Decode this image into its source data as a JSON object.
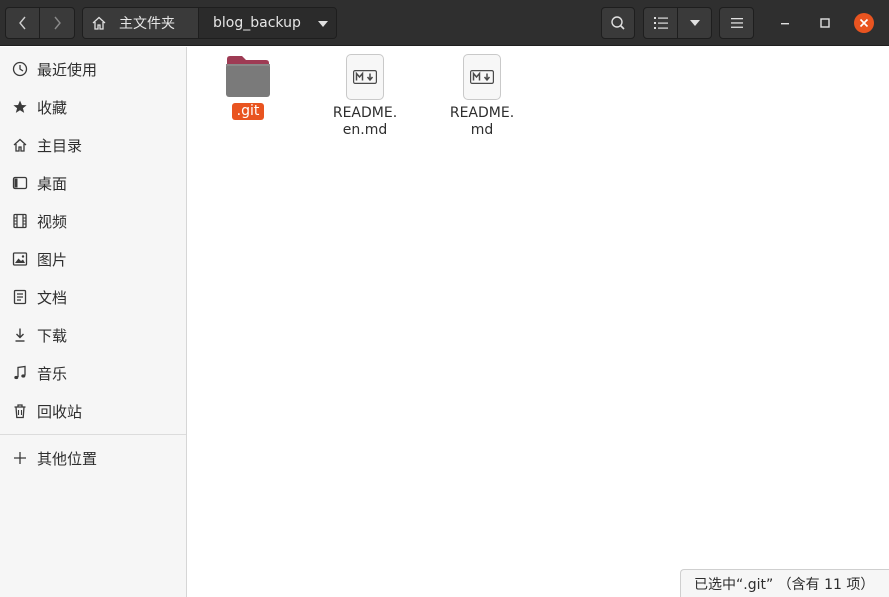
{
  "header": {
    "breadcrumb": {
      "home_label": "主文件夹",
      "current_label": "blog_backup"
    },
    "icons": {
      "back": "chevron-left-icon",
      "forward": "chevron-right-icon",
      "home": "home-icon",
      "search": "search-icon",
      "view": "list-view-icon",
      "view_options": "caret-down-icon",
      "menu": "hamburger-menu-icon",
      "minimize": "minimize-icon",
      "maximize": "maximize-icon",
      "close": "close-icon"
    },
    "close_color": "#e95420"
  },
  "sidebar": {
    "items": [
      {
        "label": "最近使用",
        "icon": "clock-icon"
      },
      {
        "label": "收藏",
        "icon": "star-icon"
      },
      {
        "label": "主目录",
        "icon": "home-icon"
      },
      {
        "label": "桌面",
        "icon": "desktop-icon"
      },
      {
        "label": "视频",
        "icon": "film-icon"
      },
      {
        "label": "图片",
        "icon": "image-icon"
      },
      {
        "label": "文档",
        "icon": "document-icon"
      },
      {
        "label": "下载",
        "icon": "download-icon"
      },
      {
        "label": "音乐",
        "icon": "music-icon"
      },
      {
        "label": "回收站",
        "icon": "trash-icon"
      }
    ],
    "other_locations": {
      "label": "其他位置",
      "icon": "plus-icon"
    }
  },
  "files": [
    {
      "name": ".git",
      "type": "folder",
      "selected": true
    },
    {
      "name": "README.\nen.md",
      "type": "markdown",
      "selected": false
    },
    {
      "name": "README.\nmd",
      "type": "markdown",
      "selected": false
    }
  ],
  "status": {
    "text": "已选中“.git” （含有 11 项）"
  },
  "colors": {
    "accent": "#e95420",
    "headerbar": "#2f2f2f",
    "folder": "#7a7a7a",
    "folder_tab": "#9e3b54"
  }
}
